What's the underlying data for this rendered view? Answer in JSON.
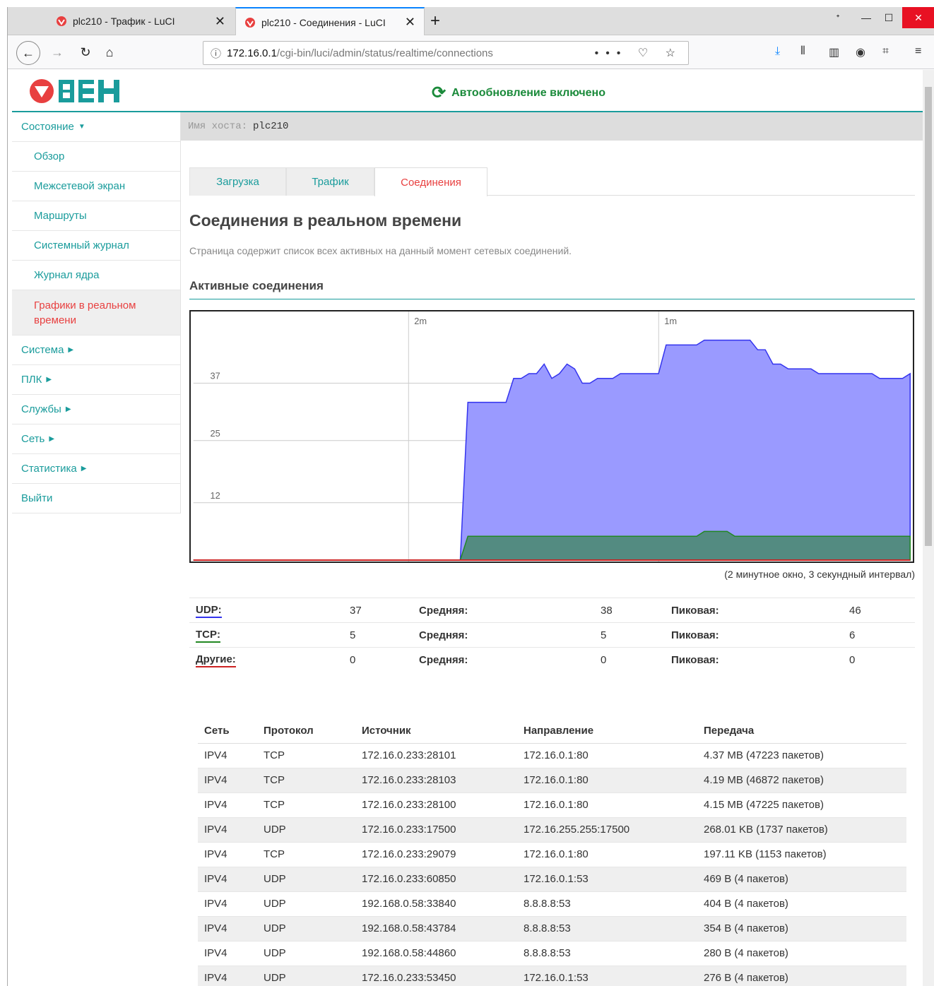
{
  "browser": {
    "tabs": [
      {
        "title": "plc210 - Трафик - LuCI",
        "active": false
      },
      {
        "title": "plc210 - Соединения - LuCI",
        "active": true
      }
    ],
    "url_prefix": "172.16.0.1",
    "url_path": "/cgi-bin/luci/admin/status/realtime/connections"
  },
  "header": {
    "logo_text": "ОВЕН",
    "autorefresh": "Автообновление включено"
  },
  "sidebar": {
    "items": [
      {
        "label": "Состояние",
        "type": "section",
        "expanded": true
      },
      {
        "label": "Обзор",
        "type": "sub"
      },
      {
        "label": "Межсетевой экран",
        "type": "sub"
      },
      {
        "label": "Маршруты",
        "type": "sub"
      },
      {
        "label": "Системный журнал",
        "type": "sub"
      },
      {
        "label": "Журнал ядра",
        "type": "sub"
      },
      {
        "label": "Графики в реальном времени",
        "type": "sub-active"
      },
      {
        "label": "Система",
        "type": "section"
      },
      {
        "label": "ПЛК",
        "type": "section"
      },
      {
        "label": "Службы",
        "type": "section"
      },
      {
        "label": "Сеть",
        "type": "section"
      },
      {
        "label": "Статистика",
        "type": "section"
      },
      {
        "label": "Выйти",
        "type": "link"
      }
    ]
  },
  "hostbar": {
    "label": "Имя хоста:",
    "value": "plc210"
  },
  "content_tabs": [
    "Загрузка",
    "Трафик",
    "Соединения"
  ],
  "page": {
    "title": "Соединения в реальном времени",
    "description": "Страница содержит список всех активных на данный момент сетевых соединений.",
    "section": "Активные соединения",
    "window_note": "(2 минутное окно, 3 секундный интервал)"
  },
  "chart_data": {
    "type": "area",
    "x_labels": [
      "2m",
      "1m"
    ],
    "y_ticks": [
      12,
      25,
      37
    ],
    "ylim": [
      0,
      52
    ],
    "series": [
      {
        "name": "UDP",
        "color": "#3333ee",
        "values": [
          0,
          0,
          0,
          0,
          0,
          0,
          0,
          0,
          0,
          0,
          0,
          0,
          0,
          0,
          0,
          0,
          0,
          0,
          0,
          0,
          0,
          0,
          0,
          0,
          0,
          0,
          0,
          0,
          0,
          0,
          0,
          0,
          0,
          0,
          0,
          0,
          33,
          33,
          33,
          33,
          33,
          33,
          38,
          38,
          39,
          39,
          41,
          38,
          39,
          41,
          40,
          37,
          37,
          38,
          38,
          38,
          39,
          39,
          39,
          39,
          39,
          39,
          45,
          45,
          45,
          45,
          45,
          46,
          46,
          46,
          46,
          46,
          46,
          46,
          44,
          44,
          41,
          41,
          40,
          40,
          40,
          40,
          39,
          39,
          39,
          39,
          39,
          39,
          39,
          39,
          38,
          38,
          38,
          38,
          39
        ]
      },
      {
        "name": "TCP",
        "color": "#228822",
        "values": [
          0,
          0,
          0,
          0,
          0,
          0,
          0,
          0,
          0,
          0,
          0,
          0,
          0,
          0,
          0,
          0,
          0,
          0,
          0,
          0,
          0,
          0,
          0,
          0,
          0,
          0,
          0,
          0,
          0,
          0,
          0,
          0,
          0,
          0,
          0,
          0,
          5,
          5,
          5,
          5,
          5,
          5,
          5,
          5,
          5,
          5,
          5,
          5,
          5,
          5,
          5,
          5,
          5,
          5,
          5,
          5,
          5,
          5,
          5,
          5,
          5,
          5,
          5,
          5,
          5,
          5,
          5,
          6,
          6,
          6,
          6,
          5,
          5,
          5,
          5,
          5,
          5,
          5,
          5,
          5,
          5,
          5,
          5,
          5,
          5,
          5,
          5,
          5,
          5,
          5,
          5,
          5,
          5,
          5,
          5
        ]
      },
      {
        "name": "Другие",
        "color": "#cc2222",
        "values": [
          0,
          0,
          0,
          0,
          0,
          0,
          0,
          0,
          0,
          0,
          0,
          0,
          0,
          0,
          0,
          0,
          0,
          0,
          0,
          0,
          0,
          0,
          0,
          0,
          0,
          0,
          0,
          0,
          0,
          0,
          0,
          0,
          0,
          0,
          0,
          0,
          0,
          0,
          0,
          0,
          0,
          0,
          0,
          0,
          0,
          0,
          0,
          0,
          0,
          0,
          0,
          0,
          0,
          0,
          0,
          0,
          0,
          0,
          0,
          0,
          0,
          0,
          0,
          0,
          0,
          0,
          0,
          0,
          0,
          0,
          0,
          0,
          0,
          0,
          0,
          0,
          0,
          0,
          0,
          0,
          0,
          0,
          0,
          0,
          0,
          0,
          0,
          0,
          0,
          0,
          0,
          0,
          0,
          0,
          0
        ]
      }
    ]
  },
  "stats": {
    "avg_label": "Средняя:",
    "peak_label": "Пиковая:",
    "rows": [
      {
        "label": "UDP:",
        "color": "#3333ee",
        "current": "37",
        "avg": "38",
        "peak": "46"
      },
      {
        "label": "TCP:",
        "color": "#228822",
        "current": "5",
        "avg": "5",
        "peak": "6"
      },
      {
        "label": "Другие:",
        "color": "#cc2222",
        "current": "0",
        "avg": "0",
        "peak": "0"
      }
    ]
  },
  "connections": {
    "headers": [
      "Сеть",
      "Протокол",
      "Источник",
      "Направление",
      "Передача"
    ],
    "rows": [
      [
        "IPV4",
        "TCP",
        "172.16.0.233:28101",
        "172.16.0.1:80",
        "4.37 MB (47223 пакетов)"
      ],
      [
        "IPV4",
        "TCP",
        "172.16.0.233:28103",
        "172.16.0.1:80",
        "4.19 MB (46872 пакетов)"
      ],
      [
        "IPV4",
        "TCP",
        "172.16.0.233:28100",
        "172.16.0.1:80",
        "4.15 MB (47225 пакетов)"
      ],
      [
        "IPV4",
        "UDP",
        "172.16.0.233:17500",
        "172.16.255.255:17500",
        "268.01 KB (1737 пакетов)"
      ],
      [
        "IPV4",
        "TCP",
        "172.16.0.233:29079",
        "172.16.0.1:80",
        "197.11 KB (1153 пакетов)"
      ],
      [
        "IPV4",
        "UDP",
        "172.16.0.233:60850",
        "172.16.0.1:53",
        "469 B (4 пакетов)"
      ],
      [
        "IPV4",
        "UDP",
        "192.168.0.58:33840",
        "8.8.8.8:53",
        "404 B (4 пакетов)"
      ],
      [
        "IPV4",
        "UDP",
        "192.168.0.58:43784",
        "8.8.8.8:53",
        "354 B (4 пакетов)"
      ],
      [
        "IPV4",
        "UDP",
        "192.168.0.58:44860",
        "8.8.8.8:53",
        "280 B (4 пакетов)"
      ],
      [
        "IPV4",
        "UDP",
        "172.16.0.233:53450",
        "172.16.0.1:53",
        "276 B (4 пакетов)"
      ]
    ]
  }
}
